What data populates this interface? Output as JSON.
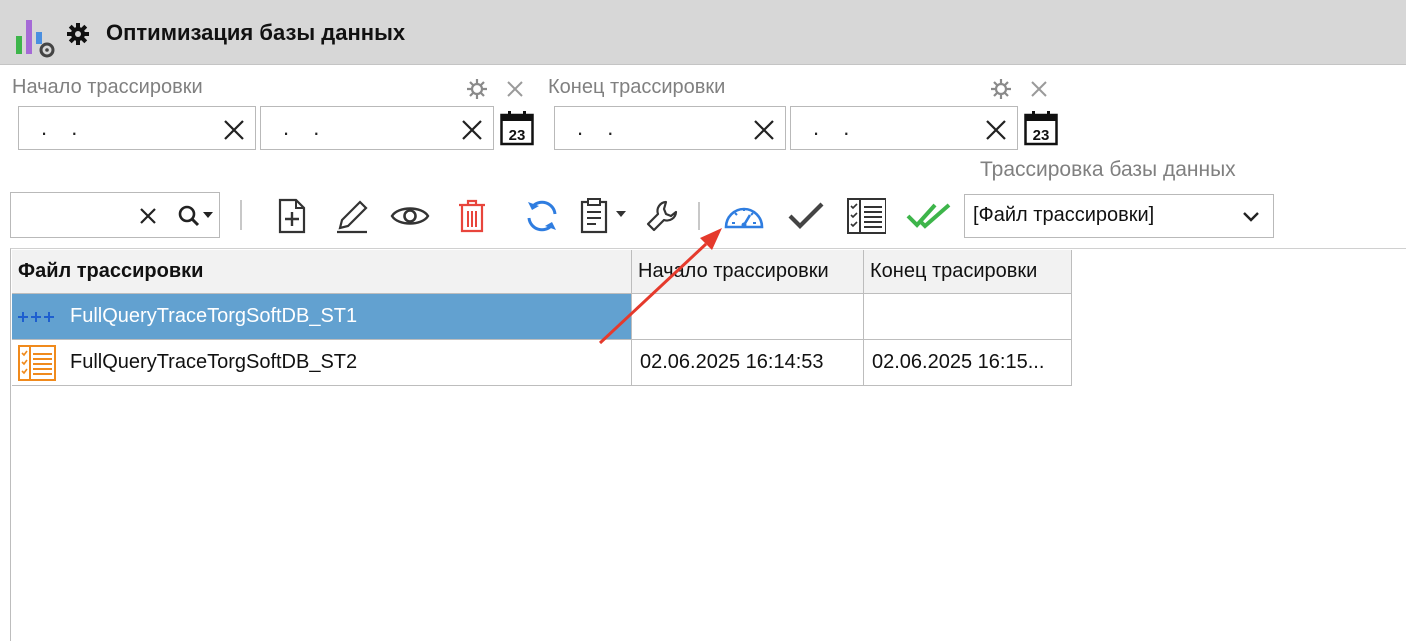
{
  "window": {
    "title": "Оптимизация базы данных"
  },
  "filters": {
    "start_label": "Начало трассировки",
    "end_label": "Конец трассировки",
    "date_placeholder": ". .",
    "calendar_text": "23",
    "trace_label": "Трассировка базы данных"
  },
  "toolbar": {
    "search_value": "",
    "group_by_value": "[Файл трассировки]"
  },
  "grid": {
    "columns": [
      "Файл трассировки",
      "Начало трассировки",
      "Конец трасировки"
    ],
    "rows": [
      {
        "file": "FullQueryTraceTorgSoftDB_ST1",
        "start": "",
        "end": "",
        "selected": true,
        "icon": "trace-running-icon"
      },
      {
        "file": "FullQueryTraceTorgSoftDB_ST2",
        "start": "02.06.2025 16:14:53",
        "end": "02.06.2025 16:15...",
        "selected": false,
        "icon": "trace-list-icon"
      }
    ]
  },
  "colors": {
    "accent_blue": "#2f7de0",
    "selected_row": "#62a1d0",
    "delete_red": "#e8453c",
    "green": "#3db54a",
    "annotation_arrow": "#e53a2c"
  }
}
